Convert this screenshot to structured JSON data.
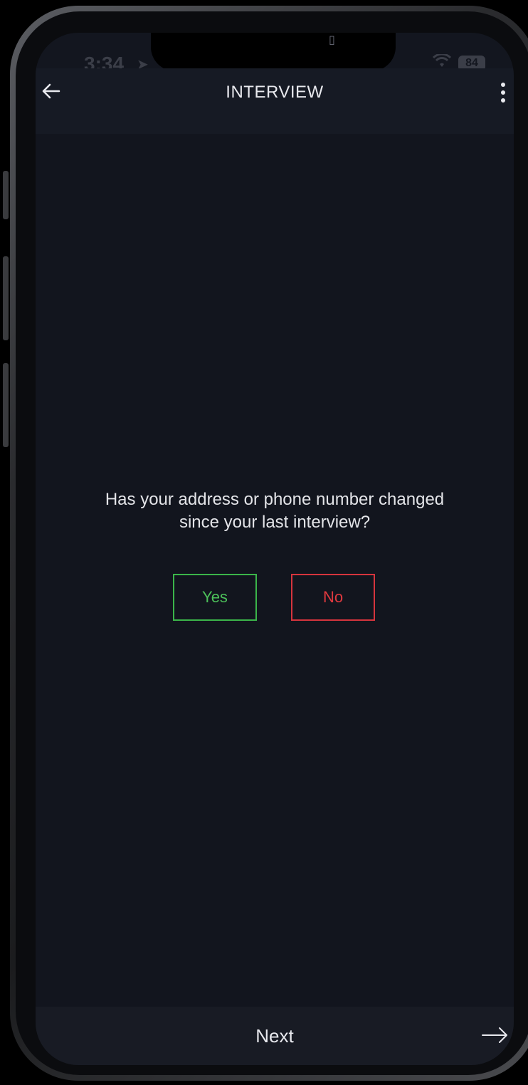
{
  "status_bar": {
    "time": "3:34",
    "battery": "84"
  },
  "header": {
    "title": "INTERVIEW"
  },
  "question": {
    "line1": "Has your address or phone number changed",
    "line2": "since your last interview?"
  },
  "answers": {
    "yes_label": "Yes",
    "no_label": "No"
  },
  "footer": {
    "next_label": "Next"
  },
  "colors": {
    "background": "#12151e",
    "yes": "#4cc15a",
    "no": "#e0393f",
    "text": "#e8e9ee"
  },
  "icons": {
    "back": "arrow-left-icon",
    "menu": "more-vertical-icon",
    "next": "arrow-right-icon",
    "location": "location-arrow-icon",
    "wifi": "wifi-icon",
    "battery": "battery-icon"
  }
}
